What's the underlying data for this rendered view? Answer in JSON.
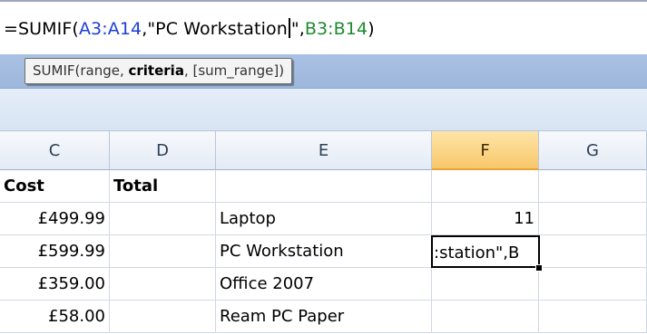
{
  "formula": {
    "prefix": "=SUMIF(",
    "range_ref": "A3:A14",
    "criteria_part1": ",\"PC Workstation",
    "criteria_part2": "\",",
    "sum_ref": "B3:B14",
    "suffix": ")"
  },
  "tooltip": {
    "func": "SUMIF(range, ",
    "bold_arg": "criteria",
    "rest": ", [sum_range])"
  },
  "columns": [
    "C",
    "D",
    "E",
    "F",
    "G"
  ],
  "active_column": "F",
  "rows": [
    {
      "C": "Cost",
      "D": "Total",
      "E": "",
      "F": "",
      "G": ""
    },
    {
      "C": "£499.99",
      "D": "",
      "E": "Laptop",
      "F": "11",
      "G": ""
    },
    {
      "C": "£599.99",
      "D": "",
      "E": "PC Workstation",
      "F": ":station\",B",
      "G": ""
    },
    {
      "C": "£359.00",
      "D": "",
      "E": "Office 2007",
      "F": "",
      "G": ""
    },
    {
      "C": "£58.00",
      "D": "",
      "E": "Ream PC Paper",
      "F": "",
      "G": ""
    }
  ],
  "colors": {
    "range_ref": "#1f3fd6",
    "sum_ref": "#1e8a2e",
    "active_header": "#f9c76a"
  }
}
